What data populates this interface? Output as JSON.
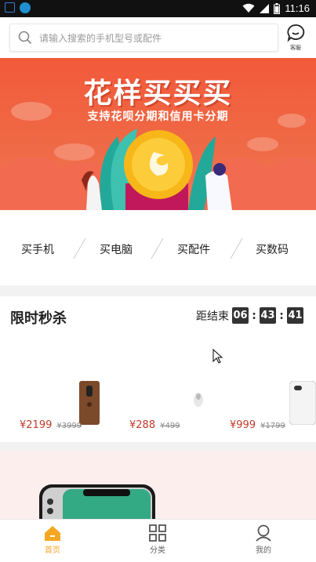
{
  "status_bar": {
    "time": "11:16"
  },
  "search": {
    "placeholder": "请输入搜索的手机型号或配件"
  },
  "service": {
    "label": "客服"
  },
  "banner": {
    "title": "花样买买买",
    "subtitle": "支持花呗分期和信用卡分期"
  },
  "categories": [
    {
      "label": "买手机"
    },
    {
      "label": "买电脑"
    },
    {
      "label": "买配件"
    },
    {
      "label": "买数码"
    }
  ],
  "flash_sale": {
    "title": "限时秒杀",
    "countdown_label": "距结束",
    "hours": "06",
    "minutes": "43",
    "seconds": "41",
    "separator": ":",
    "products": [
      {
        "price": "¥2199",
        "old_price": "¥3999"
      },
      {
        "price": "¥288",
        "old_price": "¥499"
      },
      {
        "price": "¥999",
        "old_price": "¥1799"
      }
    ]
  },
  "tabs": [
    {
      "label": "首页",
      "icon": "home-icon",
      "active": true
    },
    {
      "label": "分类",
      "icon": "grid-icon",
      "active": false
    },
    {
      "label": "我的",
      "icon": "user-icon",
      "active": false
    }
  ],
  "colors": {
    "accent": "#f5a623",
    "price": "#c0392b",
    "banner": "#f25a3a"
  }
}
